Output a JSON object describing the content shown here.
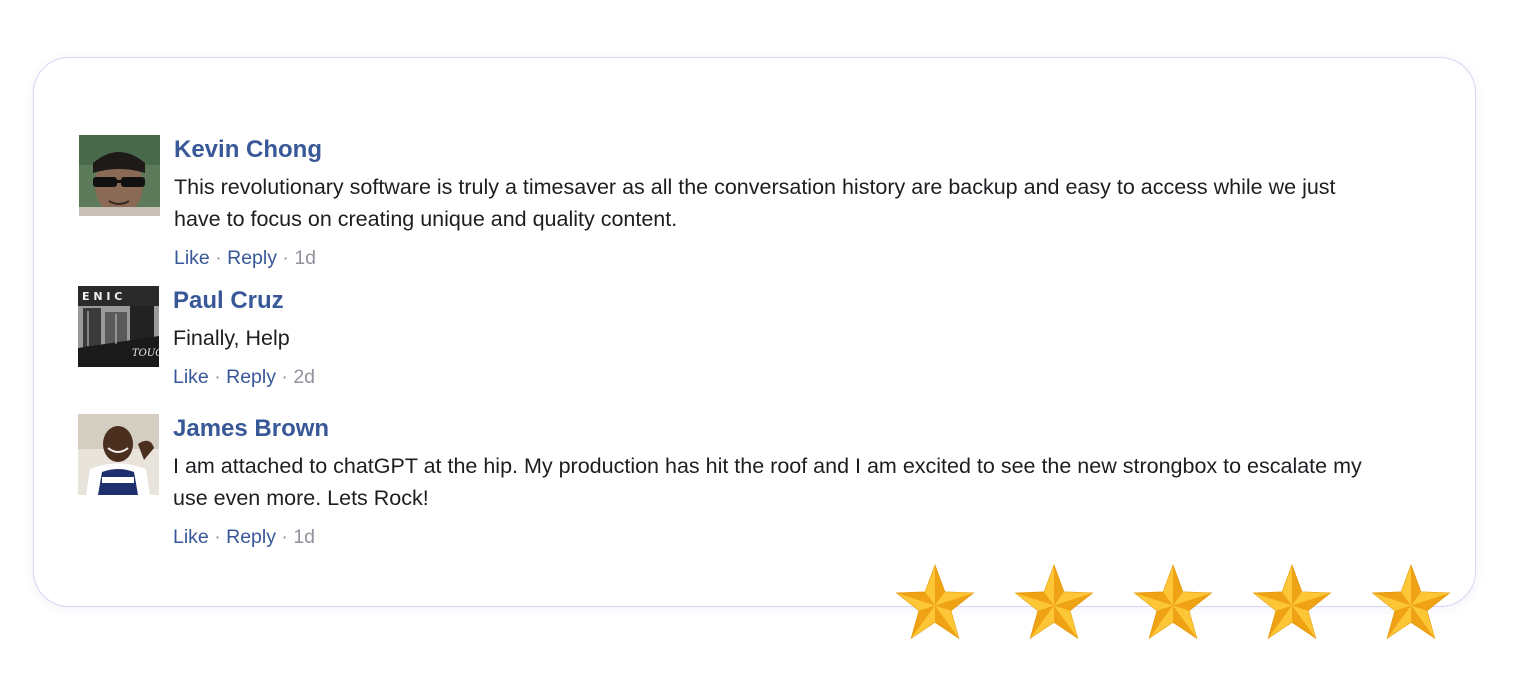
{
  "comments": [
    {
      "author": "Kevin Chong",
      "text": "This revolutionary software is truly a timesaver as all the conversation history are backup and easy to access while we just have to focus on creating unique and quality content.",
      "like": "Like",
      "reply": "Reply",
      "separator": "·",
      "time": "1d"
    },
    {
      "author": "Paul Cruz",
      "text": "Finally, Help",
      "like": "Like",
      "reply": "Reply",
      "separator": "·",
      "time": "2d"
    },
    {
      "author": "James Brown",
      "text": "I am attached to chatGPT at the hip. My production has hit the roof and I am excited to see the new strongbox to escalate my use even more. Lets Rock!",
      "like": "Like",
      "reply": "Reply",
      "separator": "·",
      "time": "1d"
    }
  ],
  "avatar_labels": {
    "paul_sign_top": "E N I C",
    "paul_sign_bottom": "TOUC OF V"
  },
  "rating": {
    "stars": 5,
    "max": 5,
    "icon": "star-icon",
    "color": "#f9b21a"
  },
  "colors": {
    "author": "#385898",
    "link": "#385898",
    "text": "#1c1e21",
    "muted": "#90949c",
    "card_border": "#d8d6f2"
  }
}
